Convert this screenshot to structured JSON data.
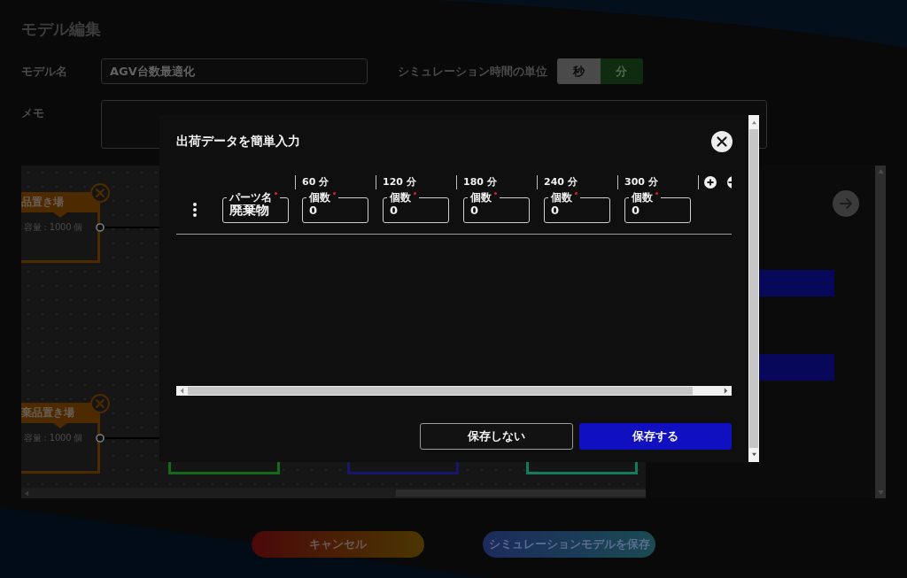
{
  "page": {
    "title": "モデル編集"
  },
  "form": {
    "model_name": {
      "label": "モデル名",
      "value": "AGV台数最適化"
    },
    "time_unit": {
      "label": "シミュレーション時間の単位",
      "options": [
        {
          "label": "秒",
          "selected": false
        },
        {
          "label": "分",
          "selected": true
        }
      ]
    },
    "memo": {
      "label": "メモ"
    }
  },
  "canvas": {
    "nodes": [
      {
        "title": "品置き場",
        "detail": "容量 : 1000 個",
        "color": "#4d2a00"
      },
      {
        "title": "棄品置き場",
        "detail": "容量 : 1000 個",
        "color": "#4d2a00"
      }
    ],
    "lower_nodes": [
      {
        "color": "#156a1a"
      },
      {
        "color": "#16166a"
      },
      {
        "color": "#137a5c"
      }
    ]
  },
  "footer_buttons": [
    {
      "label": "キャンセル",
      "kind": "cancel"
    },
    {
      "label": "シミュレーションモデルを保存",
      "kind": "save"
    }
  ],
  "dialog": {
    "title": "出荷データを簡単入力",
    "columns": [
      "60 分",
      "120 分",
      "180 分",
      "240 分",
      "300 分"
    ],
    "rows": [
      {
        "part": {
          "label": "パーツ名",
          "value": "廃棄物",
          "required": true
        },
        "counts": [
          {
            "label": "個数",
            "value": "0",
            "required": true
          },
          {
            "label": "個数",
            "value": "0",
            "required": true
          },
          {
            "label": "個数",
            "value": "0",
            "required": true
          },
          {
            "label": "個数",
            "value": "0",
            "required": true
          },
          {
            "label": "個数",
            "value": "0",
            "required": true
          }
        ]
      }
    ],
    "buttons": [
      {
        "label": "保存しない",
        "kind": "secondary"
      },
      {
        "label": "保存する",
        "kind": "primary"
      }
    ]
  }
}
